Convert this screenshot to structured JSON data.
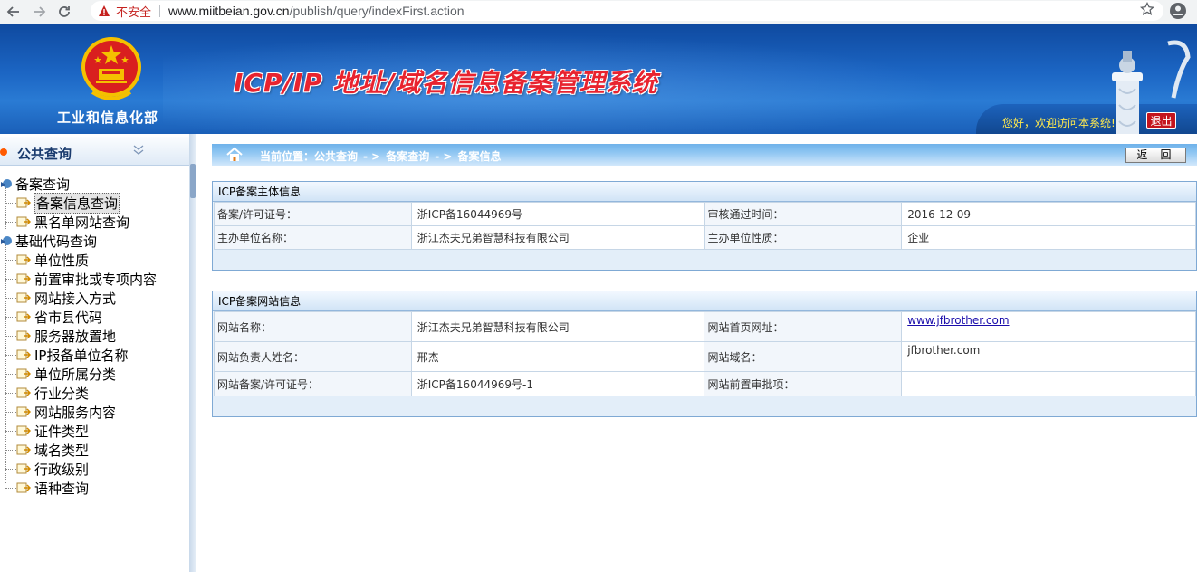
{
  "browser": {
    "security_label": "不安全",
    "url_host": "www.miitbeian.gov.cn",
    "url_path": "/publish/query/indexFirst.action",
    "icons": [
      "back-arrow-icon",
      "forward-arrow-icon",
      "reload-icon",
      "warning-icon",
      "star-icon",
      "account-icon"
    ]
  },
  "header": {
    "ministry_name": "工业和信息化部",
    "system_title": "ICP/IP 地址/域名信息备案管理系统",
    "welcome_text": "您好，欢迎访问本系统!",
    "logout_label": "退出",
    "colors": {
      "banner": "#1c66c4",
      "title": "#e8232f",
      "welcome": "#ffe94d",
      "logout": "#c4141d"
    }
  },
  "sidebar": {
    "section_title": "公共查询",
    "groups": [
      {
        "label": "备案查询",
        "items": [
          "备案信息查询",
          "黑名单网站查询"
        ]
      },
      {
        "label": "基础代码查询",
        "items": [
          "单位性质",
          "前置审批或专项内容",
          "网站接入方式",
          "省市县代码",
          "服务器放置地",
          "IP报备单位名称",
          "单位所属分类",
          "行业分类",
          "网站服务内容",
          "证件类型",
          "域名类型",
          "行政级别",
          "语种查询"
        ]
      }
    ],
    "selected": "备案信息查询"
  },
  "breadcrumb": {
    "prefix": "当前位置：公共查询",
    "sep": "- >",
    "level2": "备案查询",
    "level3": "备案信息"
  },
  "back_label": "返回",
  "subject_panel": {
    "title": "ICP备案主体信息",
    "rows": [
      {
        "k1": "备案/许可证号：",
        "v1": "浙ICP备16044969号",
        "k2": "审核通过时间：",
        "v2": "2016-12-09"
      },
      {
        "k1": "主办单位名称：",
        "v1": "浙江杰夫兄弟智慧科技有限公司",
        "k2": "主办单位性质：",
        "v2": "企业"
      }
    ]
  },
  "site_panel": {
    "title": "ICP备案网站信息",
    "rows": [
      {
        "k1": "网站名称：",
        "v1": "浙江杰夫兄弟智慧科技有限公司",
        "k2": "网站首页网址：",
        "v2": "www.jfbrother.com"
      },
      {
        "k1": "网站负责人姓名：",
        "v1": "邢杰",
        "k2": "网站域名：",
        "v2": "jfbrother.com"
      },
      {
        "k1": "网站备案/许可证号：",
        "v1": "浙ICP备16044969号-1",
        "k2": "网站前置审批项：",
        "v2": ""
      }
    ]
  }
}
